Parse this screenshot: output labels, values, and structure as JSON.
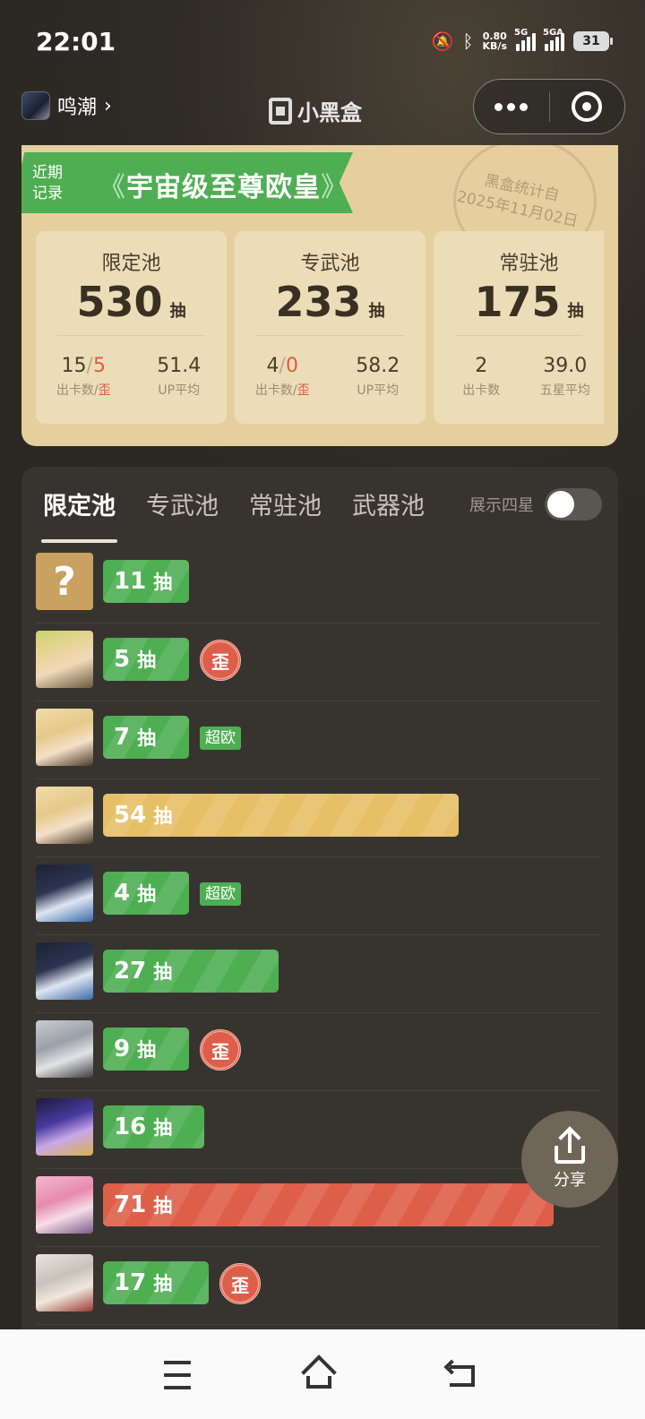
{
  "status_bar": {
    "time": "22:01",
    "net_speed_value": "0.80",
    "net_speed_unit": "KB/s",
    "signal1_label": "5G",
    "signal2_label": "5GA",
    "battery": "31"
  },
  "header": {
    "game_name": "鸣潮",
    "brand_name": "小黑盒"
  },
  "summary": {
    "ribbon_tag_line1": "近期",
    "ribbon_tag_line2": "记录",
    "title": "宇宙级至尊欧皇",
    "stamp_line1": "黑盒统计自",
    "stamp_line2": "2025年11月02日",
    "pools": [
      {
        "name": "限定池",
        "count": "530",
        "unit": "抽",
        "stat1_a": "15",
        "stat1_sep": "/",
        "stat1_b": "5",
        "stat1_label_a": "出卡数/",
        "stat1_label_b": "歪",
        "stat2": "51.4",
        "stat2_label": "UP平均"
      },
      {
        "name": "专武池",
        "count": "233",
        "unit": "抽",
        "stat1_a": "4",
        "stat1_sep": "/",
        "stat1_b": "0",
        "stat1_label_a": "出卡数/",
        "stat1_label_b": "歪",
        "stat2": "58.2",
        "stat2_label": "UP平均"
      },
      {
        "name": "常驻池",
        "count": "175",
        "unit": "抽",
        "stat1_a": "2",
        "stat1_label_a": "出卡数",
        "stat2": "39.0",
        "stat2_label": "五星平均"
      }
    ]
  },
  "tabs": [
    "限定池",
    "专武池",
    "常驻池",
    "武器池"
  ],
  "four_star_label": "展示四星",
  "four_star_enabled": false,
  "unit": "抽",
  "records": [
    {
      "pulls": "11",
      "color": "green",
      "pity_fraction": 0.175,
      "avatar": "unknown",
      "tag": ""
    },
    {
      "pulls": "5",
      "color": "green",
      "pity_fraction": 0.13,
      "avatar": "girl-blonde-green-bow",
      "tag": "歪"
    },
    {
      "pulls": "7",
      "color": "green",
      "pity_fraction": 0.145,
      "avatar": "girl-blonde-gold",
      "tag": "超欧"
    },
    {
      "pulls": "54",
      "color": "gold",
      "pity_fraction": 0.79,
      "avatar": "girl-blonde-gold",
      "tag": ""
    },
    {
      "pulls": "4",
      "color": "green",
      "pity_fraction": 0.125,
      "avatar": "girl-black-hair-blue",
      "tag": "超欧"
    },
    {
      "pulls": "27",
      "color": "green",
      "pity_fraction": 0.39,
      "avatar": "girl-black-hair-blue",
      "tag": ""
    },
    {
      "pulls": "9",
      "color": "green",
      "pity_fraction": 0.165,
      "avatar": "boy-white-hair",
      "tag": "歪"
    },
    {
      "pulls": "16",
      "color": "green",
      "pity_fraction": 0.225,
      "avatar": "girl-purple-hat",
      "tag": ""
    },
    {
      "pulls": "71",
      "color": "red",
      "pity_fraction": 1.0,
      "avatar": "girl-pink-hair",
      "tag": ""
    },
    {
      "pulls": "17",
      "color": "green",
      "pity_fraction": 0.235,
      "avatar": "girl-white-hair-red",
      "tag": "歪"
    }
  ],
  "share_label": "分享",
  "colors": {
    "green": "#4eae52",
    "gold": "#e6bf67",
    "red": "#dd5f4a",
    "card_bg": "#e5cf9f"
  }
}
